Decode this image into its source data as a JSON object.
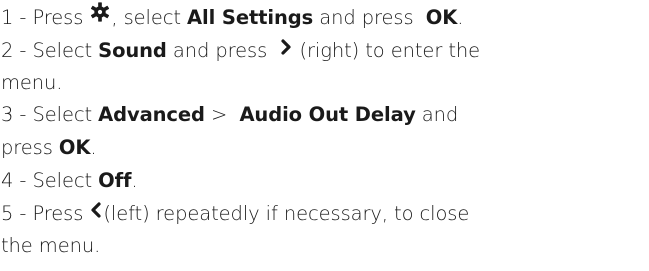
{
  "steps": [
    {
      "num": "1 -",
      "press": "Press",
      "settings_icon": "gear-icon",
      "after_icon": ", select",
      "all_settings": "All Settings",
      "and_press": "and press",
      "ok": "OK",
      "end": "."
    },
    {
      "num": "2 -",
      "select": "Select",
      "sound": "Sound",
      "and_press": "and press",
      "right_icon": "chevron-right-icon",
      "right_text": "(right) to enter the",
      "cont": "menu."
    },
    {
      "num": "3 -",
      "select": "Select",
      "advanced": "Advanced",
      "sep": ">",
      "audio_out_delay": "Audio Out Delay",
      "and": "and",
      "press": "press",
      "ok": "OK",
      "end": "."
    },
    {
      "num": "4 -",
      "select": "Select",
      "off": "Off",
      "end": "."
    },
    {
      "num": "5 -",
      "press": "Press",
      "left_icon": "chevron-left-icon",
      "left_text": "(left) repeatedly if necessary, to close",
      "cont": "the menu."
    }
  ]
}
